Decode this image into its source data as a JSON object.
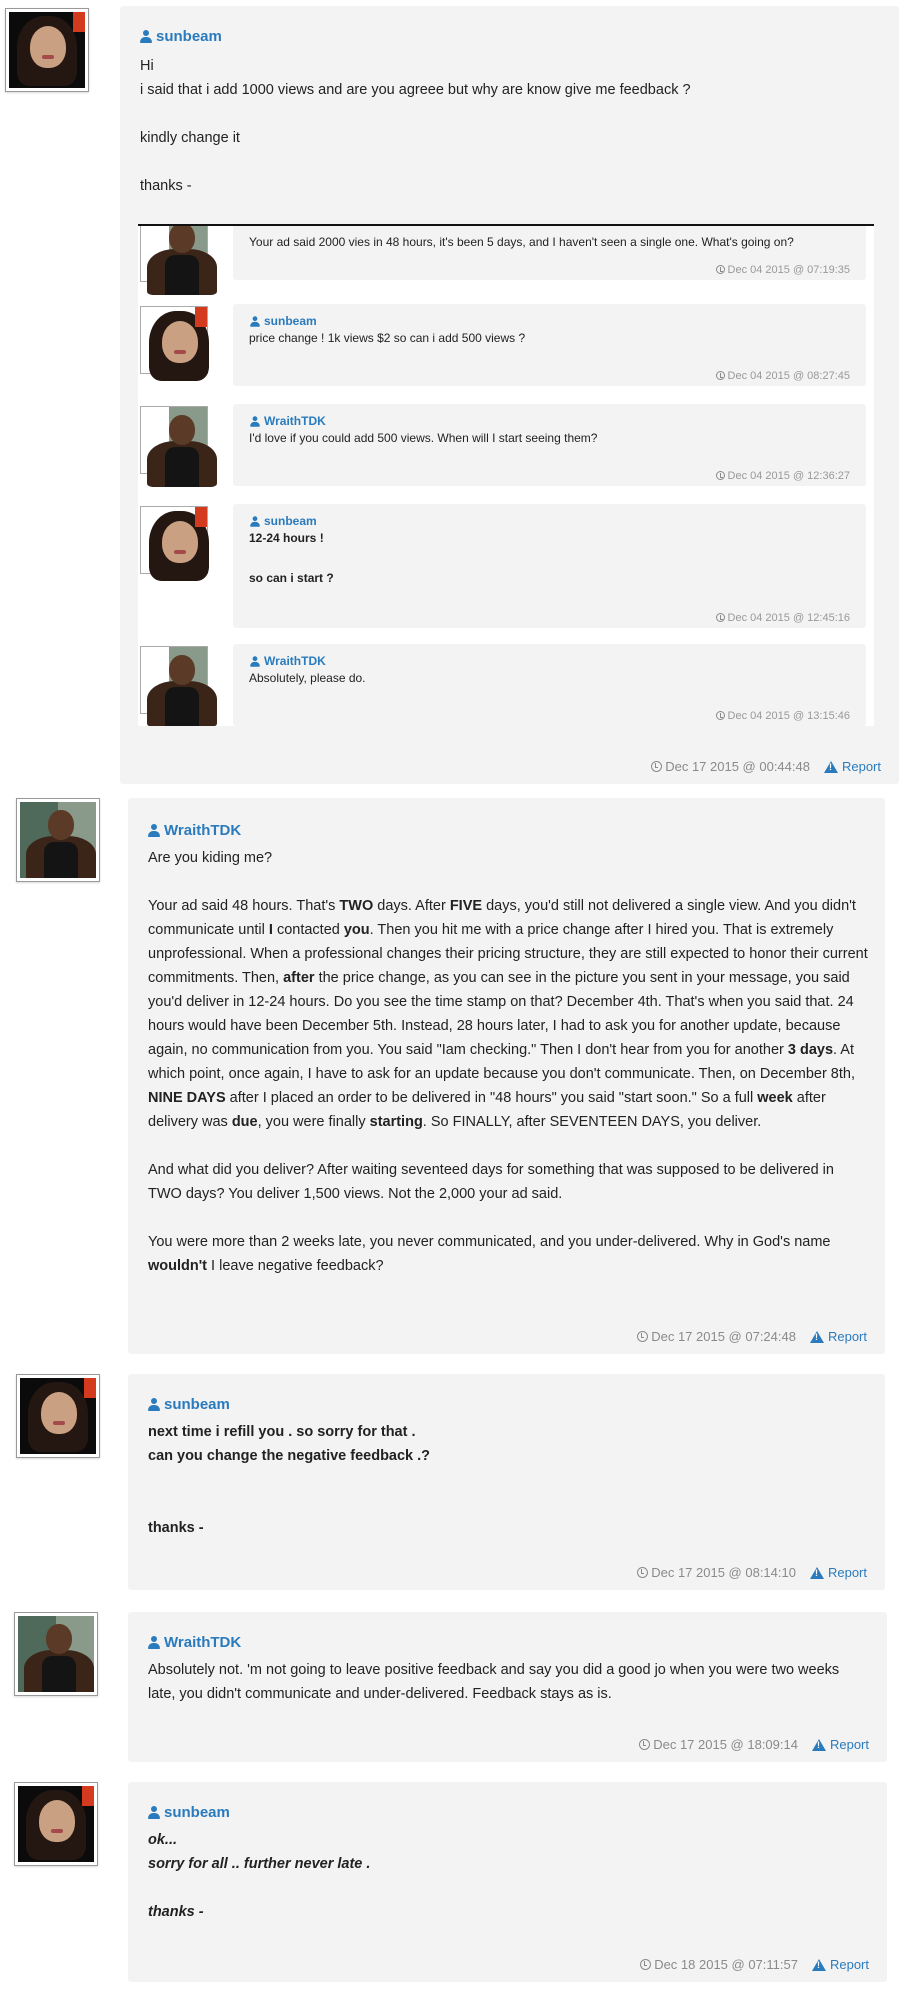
{
  "posts": [
    {
      "author": "sunbeam",
      "lines": [
        "Hi",
        "i said that i add 1000 views and are you agreee but why are know give me feedback ?",
        "",
        "kindly change it",
        "",
        "thanks -"
      ],
      "timestamp": "Dec 17 2015 @ 00:44:48",
      "report": "Report"
    },
    {
      "author": "WraithTDK",
      "timestamp": "Dec 17 2015 @ 07:24:48",
      "report": "Report"
    },
    {
      "author": "sunbeam",
      "lines": [
        "next time i refill you . so sorry for that .",
        "can you change the negative feedback .?",
        "",
        "",
        "thanks -"
      ],
      "timestamp": "Dec 17 2015 @ 08:14:10",
      "report": "Report"
    },
    {
      "author": "WraithTDK",
      "lines": [
        "Absolutely not. 'm not going to leave positive feedback and say you did a good jo when you were two weeks",
        "late, you didn't communicate and under-delivered. Feedback stays as is."
      ],
      "timestamp": "Dec 17 2015 @ 18:09:14",
      "report": "Report"
    },
    {
      "author": "sunbeam",
      "lines": [
        "ok...",
        "sorry for all .. further never late .",
        "",
        "thanks -"
      ],
      "timestamp": "Dec 18 2015 @ 07:11:57",
      "report": "Report"
    }
  ],
  "long_post": {
    "p1": "Are you kiding me?",
    "p2_segments": [
      [
        "Your ad said 48 hours. That's ",
        0
      ],
      [
        "TWO",
        1
      ],
      [
        " days. After ",
        0
      ],
      [
        "FIVE",
        1
      ],
      [
        " days, you'd still not delivered a single view. And you didn't communicate until ",
        0
      ],
      [
        "I",
        1
      ],
      [
        " contacted ",
        0
      ],
      [
        "you",
        1
      ],
      [
        ". Then you hit me with a price change after I hired you. That is extremely unprofessional. When a professional changes their pricing structure, they are still expected to honor their current commitments. Then, ",
        0
      ],
      [
        "after",
        1
      ],
      [
        " the price change, as you can see in the picture you sent in your message, you said you'd deliver in 12-24 hours. Do you see the time stamp on that? December 4th. That's when you said that. 24 hours would have been December 5th. Instead, 28 hours later, I had to ask you for another update, because again, no communication from you. You said \"Iam checking.\" Then I don't hear from you for another ",
        0
      ],
      [
        "3 days",
        1
      ],
      [
        ". At which point, once again, I have to ask for an update because you don't communicate. Then, on December 8th, ",
        0
      ],
      [
        "NINE DAYS",
        1
      ],
      [
        " after I placed an order to be delivered in \"48 hours\" you said \"start soon.\" So a full ",
        0
      ],
      [
        "week",
        1
      ],
      [
        " after delivery was ",
        0
      ],
      [
        "due",
        1
      ],
      [
        ", you were finally ",
        0
      ],
      [
        "starting",
        1
      ],
      [
        ". So FINALLY, after SEVENTEEN DAYS, you deliver.",
        0
      ]
    ],
    "p3": "And what did you deliver? After waiting seventeed days for something that was supposed to be delivered in TWO days? You deliver 1,500 views. Not the 2,000 your ad said.",
    "p4_segments": [
      [
        "You were more than 2 weeks late, you never communicated, and you under-delivered. Why in God's name ",
        0
      ],
      [
        "wouldn't",
        1
      ],
      [
        " I leave negative feedback?",
        0
      ]
    ]
  },
  "embedded": [
    {
      "author": "WraithTDK",
      "lines": [
        "Your ad said 2000 vies in 48 hours, it's been 5 days, and I haven't seen a single one. What's going on?"
      ],
      "time": "Dec 04 2015 @ 07:19:35",
      "bold": false
    },
    {
      "author": "sunbeam",
      "lines": [
        "price change ! 1k views $2 so can i add 500 views ?"
      ],
      "time": "Dec 04 2015 @ 08:27:45",
      "bold": false
    },
    {
      "author": "WraithTDK",
      "lines": [
        "I'd love if you could add 500 views. When will I start seeing them?"
      ],
      "time": "Dec 04 2015 @ 12:36:27",
      "bold": false
    },
    {
      "author": "sunbeam",
      "lines": [
        "12-24 hours !",
        "",
        "so can i start ?"
      ],
      "time": "Dec 04 2015 @ 12:45:16",
      "bold": true
    },
    {
      "author": "WraithTDK",
      "lines": [
        "Absolutely, please do."
      ],
      "time": "Dec 04 2015 @ 13:15:46",
      "bold": false
    }
  ]
}
